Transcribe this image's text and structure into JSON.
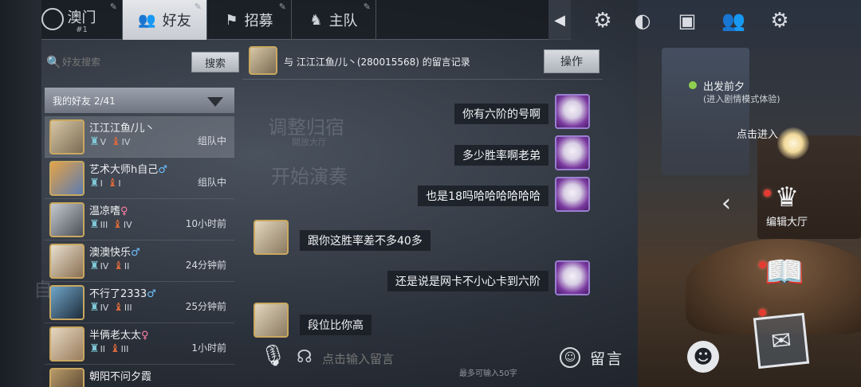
{
  "tabs": [
    {
      "label": "澳门",
      "sub": "#1"
    },
    {
      "label": "好友"
    },
    {
      "label": "招募"
    },
    {
      "label": "主队"
    }
  ],
  "search": {
    "placeholder": "好友搜索",
    "button": "搜索"
  },
  "friend_group": {
    "label": "我的好友  2/41"
  },
  "friends": [
    {
      "name": "江江江鱼/儿丶",
      "gender": "",
      "badge1": "V",
      "badge2": "IV",
      "status": "组队中"
    },
    {
      "name": "艺术大师h自己",
      "gender": "♂",
      "badge1": "I",
      "badge2": "I",
      "status": "组队中"
    },
    {
      "name": "温凉嗜",
      "gender": "♀",
      "badge1": "III",
      "badge2": "IV",
      "status": "10小时前"
    },
    {
      "name": "澳澳快乐",
      "gender": "♂",
      "badge1": "IV",
      "badge2": "II",
      "status": "24分钟前"
    },
    {
      "name": "不行了2333",
      "gender": "♂",
      "badge1": "IV",
      "badge2": "III",
      "status": "25分钟前"
    },
    {
      "name": "半俩老太太",
      "gender": "♀",
      "badge1": "II",
      "badge2": "III",
      "status": "1小时前"
    },
    {
      "name": "朝阳不问夕霞",
      "gender": "",
      "badge1": "",
      "badge2": "",
      "status": ""
    }
  ],
  "chat": {
    "title": "与  江江江鱼/儿丶(280015568)  的留言记录",
    "op_button": "操作",
    "messages": [
      {
        "side": "right",
        "text": "你有六阶的号啊"
      },
      {
        "side": "right",
        "text": "多少胜率啊老弟"
      },
      {
        "side": "right",
        "text": "也是18吗哈哈哈哈哈哈"
      },
      {
        "side": "left",
        "text": "跟你这胜率差不多40多"
      },
      {
        "side": "right",
        "text": "还是说是网卡不小心卡到六阶"
      },
      {
        "side": "left",
        "text": "段位比你高"
      }
    ],
    "ghost_text": [
      "调整归宿",
      "開放大厅",
      "开始演奏",
      "自"
    ],
    "input_placeholder": "点击输入留言",
    "input_hint": "最多可输入50字",
    "send_label": "留言"
  },
  "quest": {
    "title": "出发前夕",
    "subtitle": "(进入剧情模式体验)",
    "enter_label": "点击进入"
  },
  "edit_hall_label": "编辑大厅",
  "colors": {
    "accent_gold": "#c9a860",
    "notify_red": "#e33b32",
    "quest_green": "#8fd14f"
  }
}
